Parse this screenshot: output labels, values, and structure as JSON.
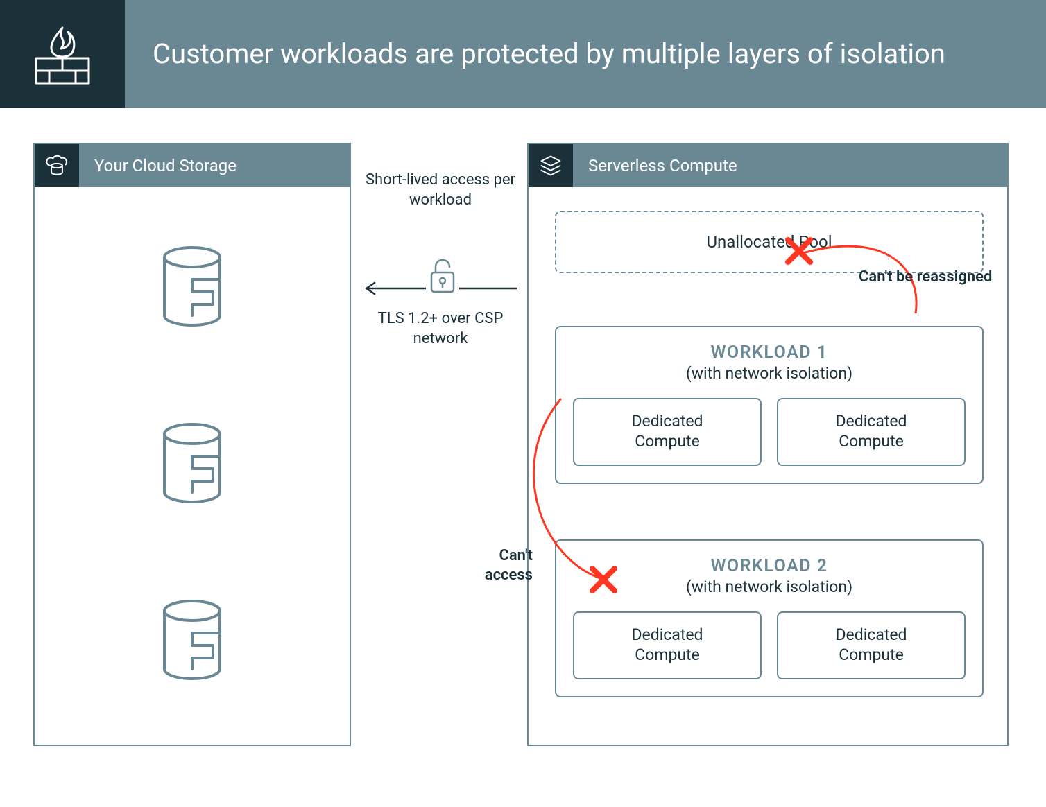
{
  "header": {
    "title": "Customer workloads are protected by multiple layers of isolation"
  },
  "left_panel": {
    "title": "Your Cloud Storage"
  },
  "right_panel": {
    "title": "Serverless Compute",
    "pool": "Unallocated Pool",
    "workloads": [
      {
        "title": "WORKLOAD 1",
        "subtitle": "(with network isolation)",
        "compute": [
          "Dedicated\nCompute",
          "Dedicated\nCompute"
        ]
      },
      {
        "title": "WORKLOAD 2",
        "subtitle": "(with network isolation)",
        "compute": [
          "Dedicated\nCompute",
          "Dedicated\nCompute"
        ]
      }
    ]
  },
  "arrow": {
    "above": "Short-lived access per workload",
    "below": "TLS 1.2+ over CSP network"
  },
  "labels": {
    "cant_reassign": "Can't be reassigned",
    "cant_access": "Can't access"
  },
  "colors": {
    "dark": "#1B3139",
    "mid": "#6A8894",
    "red": "#FF3621"
  }
}
